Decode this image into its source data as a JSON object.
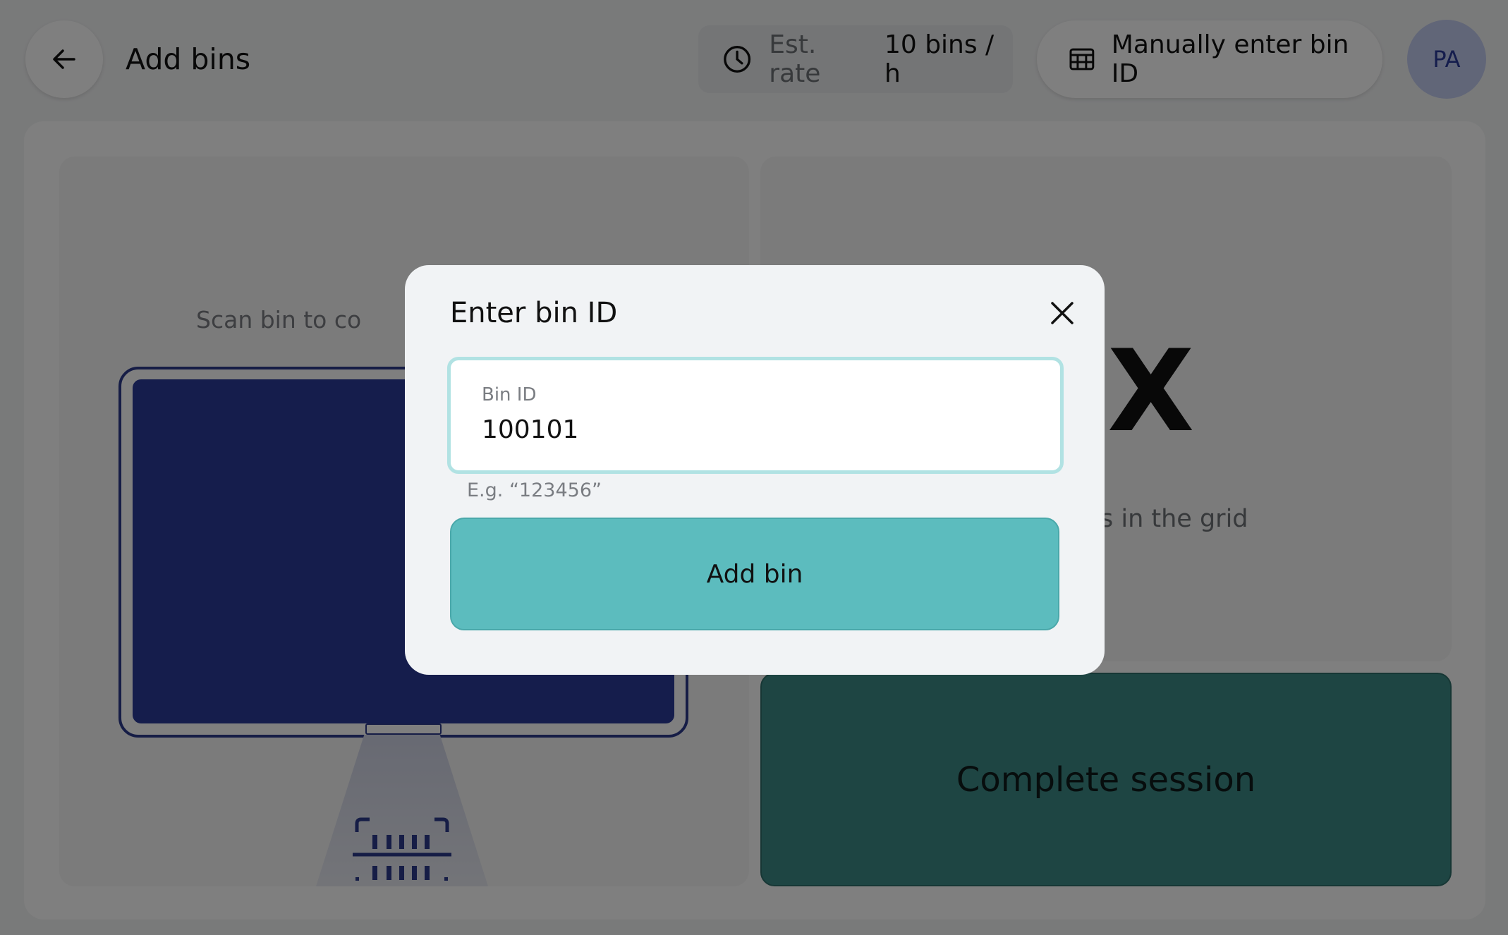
{
  "header": {
    "title": "Add bins",
    "back_icon": "arrow-left-icon",
    "rate_label": "Est. rate",
    "rate_value": "10 bins / h",
    "manual_label": "Manually enter bin ID",
    "avatar_initials": "PA"
  },
  "main": {
    "scan_text": "Scan bin to co",
    "bin_count": "X",
    "grid_text": "s in the grid",
    "complete_label": "Complete session"
  },
  "modal": {
    "title": "Enter bin ID",
    "input_label": "Bin ID",
    "input_value": "100101",
    "helper_text": "E.g. “123456”",
    "add_label": "Add bin"
  },
  "colors": {
    "accent": "#5cbcbe",
    "complete_bg": "#3d8a86",
    "device_screen": "#2b3a99",
    "avatar_bg": "#c3ccf0"
  }
}
